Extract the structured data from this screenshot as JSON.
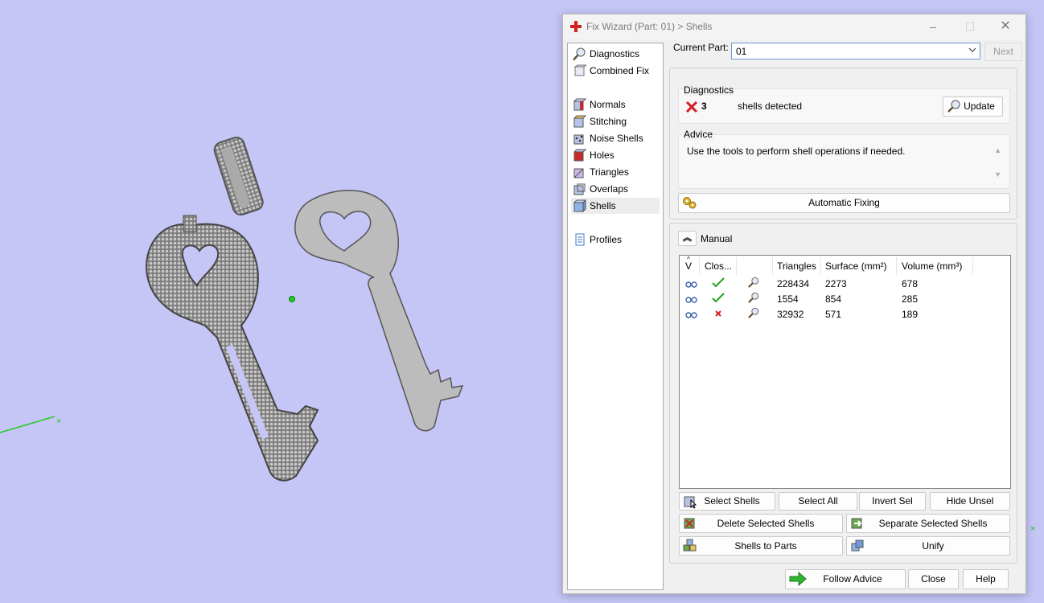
{
  "window": {
    "title": "Fix Wizard (Part: 01) > Shells"
  },
  "nav": {
    "items": [
      {
        "label": "Diagnostics",
        "icon": "magnifier-icon"
      },
      {
        "label": "Combined Fix",
        "icon": "combined-fix-icon"
      },
      {
        "label": "Normals",
        "icon": "normals-cube-icon"
      },
      {
        "label": "Stitching",
        "icon": "stitching-cube-icon"
      },
      {
        "label": "Noise Shells",
        "icon": "noise-shells-icon"
      },
      {
        "label": "Holes",
        "icon": "holes-cube-icon"
      },
      {
        "label": "Triangles",
        "icon": "triangles-cube-icon"
      },
      {
        "label": "Overlaps",
        "icon": "overlaps-cube-icon"
      },
      {
        "label": "Shells",
        "icon": "shells-cube-icon"
      },
      {
        "label": "Profiles",
        "icon": "profiles-document-icon"
      }
    ],
    "selected": "Shells"
  },
  "part": {
    "label": "Current Part:",
    "value": "01",
    "next_label": "Next"
  },
  "diagnostics": {
    "title": "Diagnostics",
    "count": "3",
    "text": "shells detected",
    "update_label": "Update"
  },
  "advice": {
    "title": "Advice",
    "text": "Use the tools to perform shell operations if needed."
  },
  "automatic_fixing_label": "Automatic Fixing",
  "manual": {
    "title": "Manual",
    "columns": [
      "V",
      "Clos...",
      "",
      "Triangles",
      "Surface (mm²)",
      "Volume (mm³)"
    ],
    "rows": [
      {
        "closed": true,
        "triangles": "228434",
        "surface": "2273",
        "volume": "678"
      },
      {
        "closed": true,
        "triangles": "1554",
        "surface": "854",
        "volume": "285"
      },
      {
        "closed": false,
        "triangles": "32932",
        "surface": "571",
        "volume": "189"
      }
    ]
  },
  "buttons": {
    "select_shells": "Select Shells",
    "select_all": "Select All",
    "invert_sel": "Invert Sel",
    "hide_unsel": "Hide Unsel",
    "delete_selected": "Delete Selected Shells",
    "separate_selected": "Separate Selected Shells",
    "shells_to_parts": "Shells to Parts",
    "unify": "Unify",
    "follow_advice": "Follow Advice",
    "close": "Close",
    "help": "Help"
  },
  "colors": {
    "viewport_bg": "#c5c6f6",
    "key_mesh": "#8a8a8a",
    "key_flat": "#bcbcbc",
    "axis_green": "#22cc22",
    "error_red": "#d42020",
    "ok_green": "#1fa21f",
    "accent_blue": "#6f95d3"
  }
}
